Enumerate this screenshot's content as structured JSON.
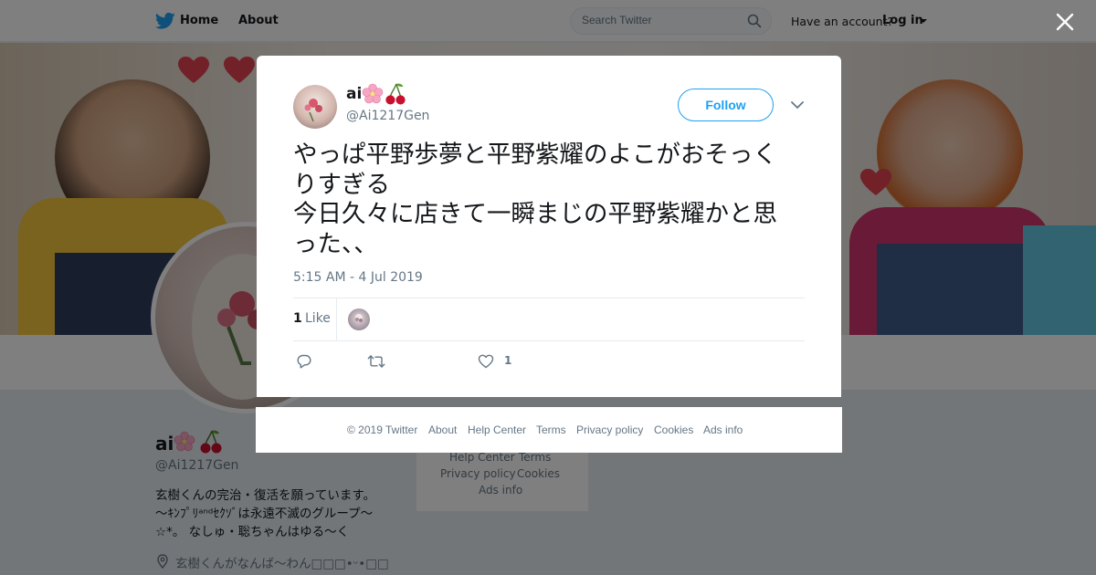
{
  "nav": {
    "home_label": "Home",
    "about_label": "About",
    "search_placeholder": "Search Twitter",
    "have_account": "Have an account?",
    "login_label": "Log in"
  },
  "profile": {
    "name": "ai",
    "handle": "@Ai1217Gen",
    "bio_lines": [
      "玄樹くんの完治・復活を願っています。",
      "〜ｷﾝﾌﾟﾘᵃⁿᵈｾｸｿﾞは永遠不滅のグループ〜",
      "☆*。 なしゅ・聡ちゃんはゆる〜く"
    ],
    "location": "玄樹くんがなんば〜わん□□□•ᵕ•□□",
    "side_links": [
      "Help Center",
      "Terms",
      "Privacy policy",
      "Cookies",
      "Ads info"
    ]
  },
  "tweet": {
    "author_name": "ai",
    "author_handle": "@Ai1217Gen",
    "follow_label": "Follow",
    "text_lines": [
      "やっぱ平野歩夢と平野紫耀のよこがおそっく",
      "りすぎる",
      "今日久々に店きて一瞬まじの平野紫耀かと思",
      "った、、"
    ],
    "timestamp": "5:15 AM - 4 Jul 2019",
    "likes_count": "1",
    "likes_label": "Like",
    "action_like_count": "1"
  },
  "footer": {
    "copyright": "© 2019 Twitter",
    "about": "About",
    "help_center": "Help Center",
    "terms": "Terms",
    "privacy": "Privacy policy",
    "cookies": "Cookies",
    "ads_info": "Ads info"
  },
  "colors": {
    "accent": "#1da1f2",
    "text_secondary": "#657786",
    "overlay": "rgba(0,0,0,0.5)"
  },
  "icons": [
    "twitter-bird-icon",
    "search-icon",
    "close-icon",
    "chevron-down-icon",
    "sakura-emoji-icon",
    "cherry-emoji-icon",
    "reply-icon",
    "retweet-icon",
    "heart-icon",
    "location-pin-icon"
  ]
}
